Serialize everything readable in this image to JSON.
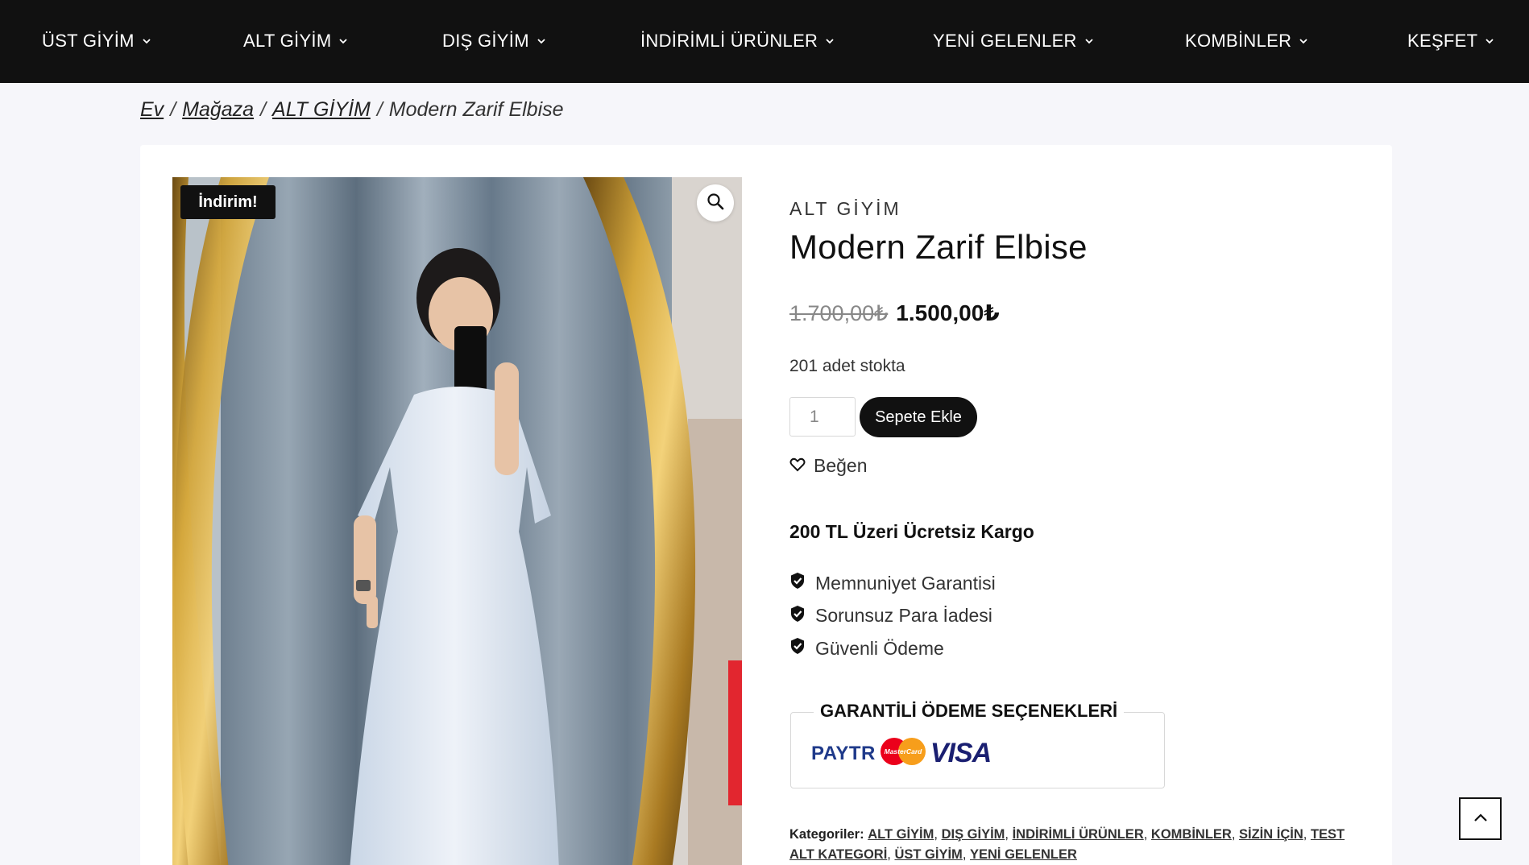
{
  "nav": {
    "items": [
      {
        "label": "ÜST GİYİM"
      },
      {
        "label": "ALT GİYİM"
      },
      {
        "label": "DIŞ GİYİM"
      },
      {
        "label": "İNDİRİMLİ ÜRÜNLER"
      },
      {
        "label": "YENİ GELENLER"
      },
      {
        "label": "KOMBİNLER"
      },
      {
        "label": "KEŞFET"
      }
    ]
  },
  "breadcrumb": {
    "home": "Ev",
    "shop": "Mağaza",
    "category": "ALT GİYİM",
    "current": "Modern Zarif Elbise",
    "separator": "/"
  },
  "product": {
    "sale_badge": "İndirim!",
    "category": "ALT GİYİM",
    "title": "Modern Zarif Elbise",
    "price_old": "1.700,00₺",
    "price_new": "1.500,00₺",
    "stock": "201 adet stokta",
    "quantity": "1",
    "add_to_cart": "Sepete Ekle",
    "like": "Beğen",
    "shipping": "200 TL Üzeri Ücretsiz Kargo",
    "features": [
      "Memnuniyet Garantisi",
      "Sorunsuz Para İadesi",
      "Güvenli Ödeme"
    ],
    "payment_title": "GARANTİLİ ÖDEME SEÇENEKLERİ",
    "payment_logos": {
      "paytr_pay": "PAY",
      "paytr_tr": "TR",
      "mastercard": "MasterCard",
      "visa": "VISA"
    },
    "meta": {
      "label": "Kategoriler:",
      "categories": [
        "ALT GİYİM",
        "DIŞ GİYİM",
        "İNDİRİMLİ ÜRÜNLER",
        "KOMBİNLER",
        "SİZİN İÇİN",
        "TEST ALT KATEGORİ",
        "ÜST GİYİM",
        "YENİ GELENLER"
      ]
    }
  },
  "icons": {
    "nav_chevron": "chevron-down-icon",
    "zoom": "magnifier-icon",
    "like": "heart-icon",
    "feature": "shield-check-icon",
    "scroll_top": "chevron-up-icon"
  },
  "colors": {
    "nav_bg": "#111111",
    "page_bg": "#f6f6fa",
    "button_bg": "#111111",
    "mastercard_red": "#eb001b",
    "mastercard_orange": "#f79e1b",
    "visa_blue": "#1a1f71"
  }
}
